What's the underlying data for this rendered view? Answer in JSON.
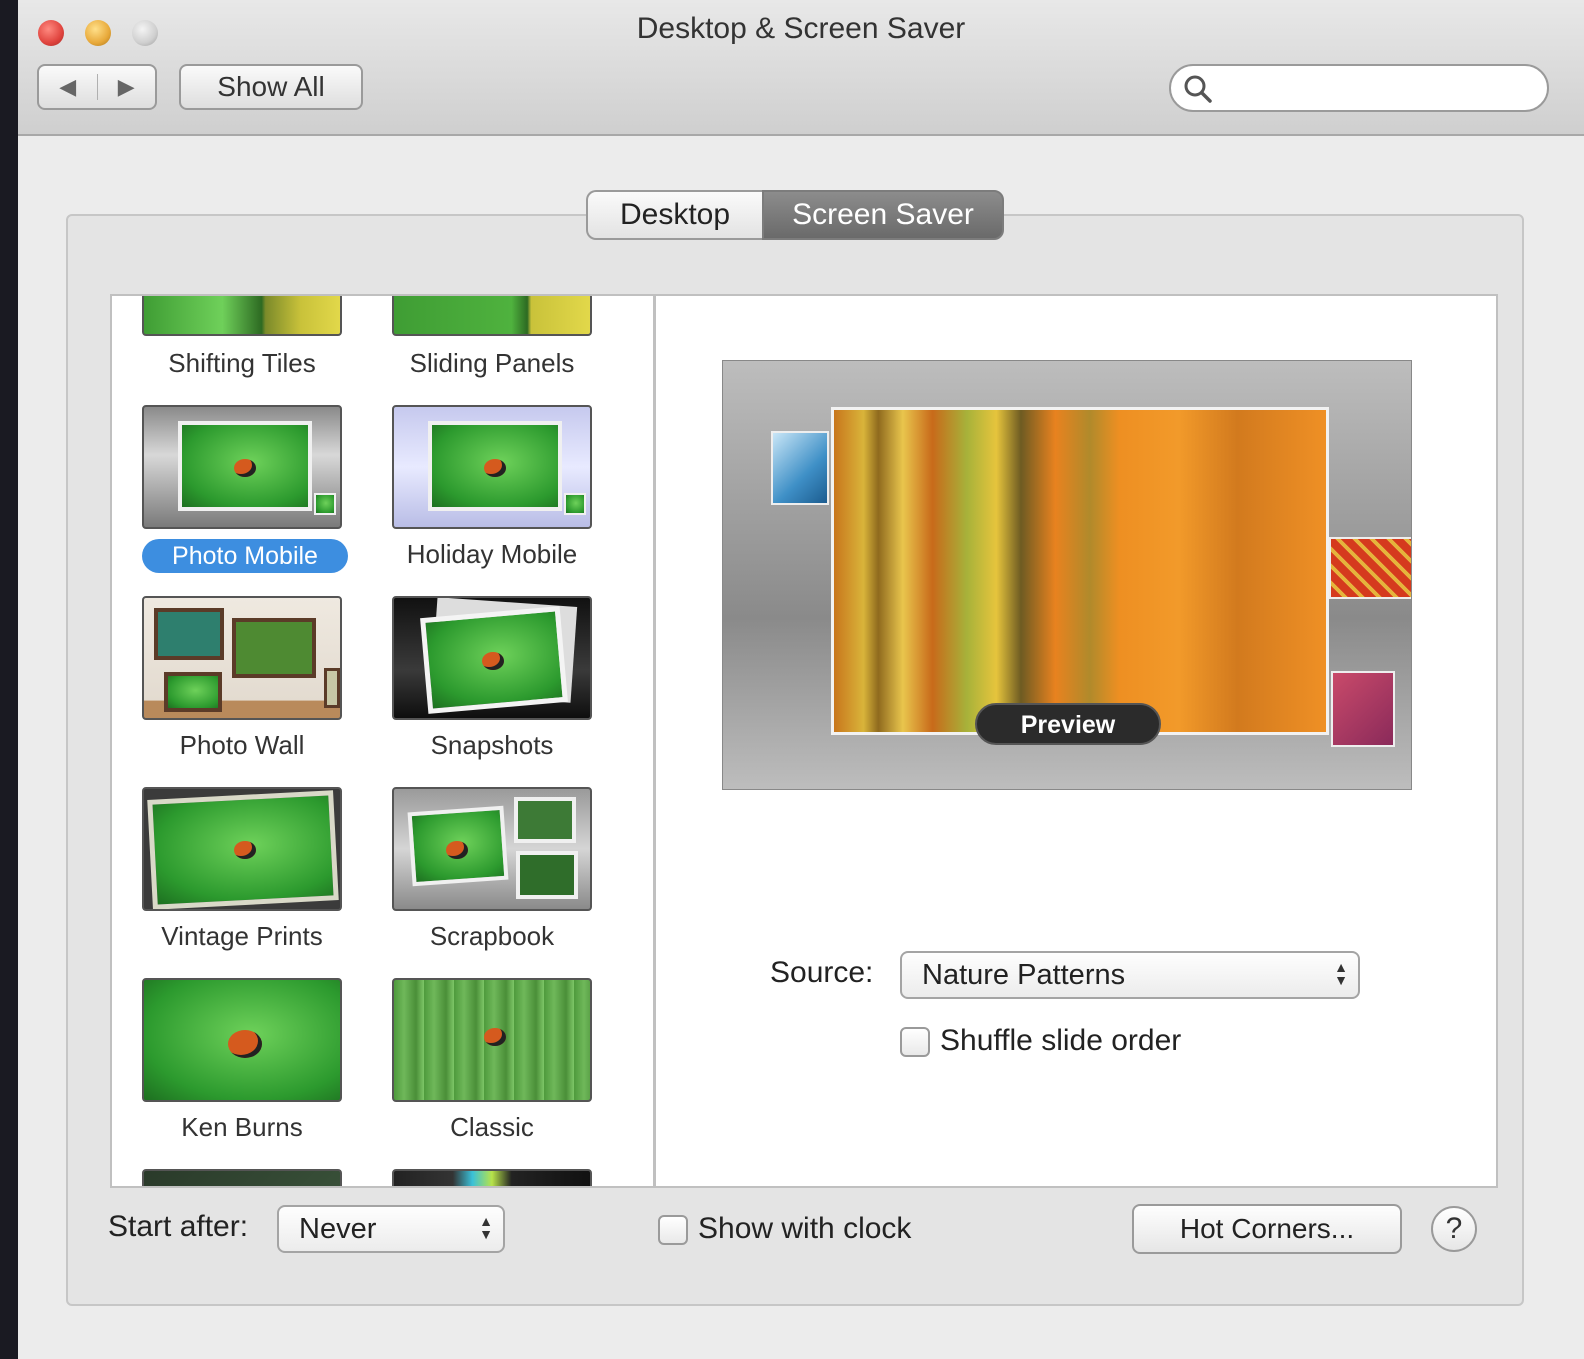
{
  "window": {
    "title": "Desktop & Screen Saver",
    "back_glyph": "◀",
    "forward_glyph": "▶",
    "show_all_label": "Show All",
    "search_placeholder": ""
  },
  "tabs": [
    {
      "label": "Desktop",
      "selected": false
    },
    {
      "label": "Screen Saver",
      "selected": true
    }
  ],
  "savers": [
    {
      "label": "Shifting Tiles",
      "icon": "shifting-tiles-thumbnail"
    },
    {
      "label": "Sliding Panels",
      "icon": "sliding-panels-thumbnail"
    },
    {
      "label": "Photo Mobile",
      "icon": "photo-mobile-thumbnail",
      "selected": true
    },
    {
      "label": "Holiday Mobile",
      "icon": "holiday-mobile-thumbnail"
    },
    {
      "label": "Photo Wall",
      "icon": "photo-wall-thumbnail"
    },
    {
      "label": "Snapshots",
      "icon": "snapshots-thumbnail"
    },
    {
      "label": "Vintage Prints",
      "icon": "vintage-prints-thumbnail"
    },
    {
      "label": "Scrapbook",
      "icon": "scrapbook-thumbnail"
    },
    {
      "label": "Ken Burns",
      "icon": "ken-burns-thumbnail"
    },
    {
      "label": "Classic",
      "icon": "classic-thumbnail"
    }
  ],
  "preview": {
    "button_label": "Preview"
  },
  "source": {
    "label": "Source:",
    "value": "Nature Patterns"
  },
  "shuffle": {
    "label": "Shuffle slide order",
    "checked": false
  },
  "bottom": {
    "start_after_label": "Start after:",
    "start_after_value": "Never",
    "show_clock_label": "Show with clock",
    "show_clock_checked": false,
    "hot_corners_label": "Hot Corners...",
    "help_label": "?"
  },
  "colors": {
    "selection": "#3d8ee0",
    "close": "#e0443e",
    "minimize": "#e8a93a",
    "zoom": "#cfcfcf"
  }
}
